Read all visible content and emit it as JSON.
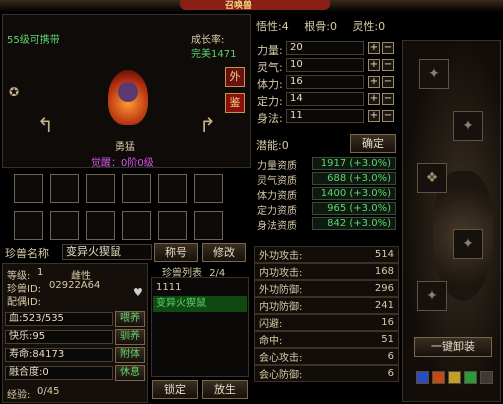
{
  "title": "召唤兽",
  "pet": {
    "level_text": "55级可携带",
    "growth_label": "成长率:",
    "growth_value": "完美1471",
    "name": "勇猛",
    "awaken": "觉醒：0阶0级",
    "btn_wai": "外",
    "btn_jian": "鉴"
  },
  "top_stats": {
    "wuxing_label": "悟性:",
    "wuxing_value": "4",
    "genggu_label": "根骨:",
    "genggu_value": "0",
    "lingxing_label": "灵性:",
    "lingxing_value": "0"
  },
  "attributes": [
    {
      "label": "力量:",
      "value": "20"
    },
    {
      "label": "灵气:",
      "value": "10"
    },
    {
      "label": "体力:",
      "value": "16"
    },
    {
      "label": "定力:",
      "value": "14"
    },
    {
      "label": "身法:",
      "value": "11"
    }
  ],
  "potential": {
    "label": "潜能:",
    "value": "0",
    "confirm": "确定"
  },
  "aptitudes": [
    {
      "label": "力量资质",
      "value": "1917 (+3.0%)"
    },
    {
      "label": "灵气资质",
      "value": "688 (+3.0%)"
    },
    {
      "label": "体力资质",
      "value": "1400 (+3.0%)"
    },
    {
      "label": "定力资质",
      "value": "965 (+3.0%)"
    },
    {
      "label": "身法资质",
      "value": "842 (+3.0%)"
    }
  ],
  "combat_stats": [
    {
      "label": "外功攻击:",
      "value": "514"
    },
    {
      "label": "内功攻击:",
      "value": "168"
    },
    {
      "label": "外功防御:",
      "value": "296"
    },
    {
      "label": "内功防御:",
      "value": "241"
    },
    {
      "label": "闪避:",
      "value": "16"
    },
    {
      "label": "命中:",
      "value": "51"
    },
    {
      "label": "会心攻击:",
      "value": "6"
    },
    {
      "label": "会心防御:",
      "value": "6"
    }
  ],
  "info": {
    "name_label": "珍兽名称",
    "name_value": "变异火猰鼠",
    "title_btn": "称号",
    "modify_btn": "修改",
    "level_label": "等级:",
    "level_value": "1",
    "gender": "雌性",
    "id_label": "珍兽ID:",
    "id_value": "02922A64",
    "mate_label": "配偶ID:",
    "hp_label": "血:",
    "hp_value": "523/535",
    "joy_label": "快乐:",
    "joy_value": "95",
    "life_label": "寿命:",
    "life_value": "84173",
    "fusion_label": "融合度:",
    "fusion_value": "0",
    "exp_label": "经验:",
    "exp_value": "0/45",
    "feed_btn": "喂养",
    "tame_btn": "驯养",
    "attach_btn": "附体",
    "rest_btn": "休息"
  },
  "pet_list": {
    "header": "珍兽列表",
    "count": "2/4",
    "items": [
      "1111",
      "变异火猰鼠"
    ],
    "lock_btn": "锁定",
    "release_btn": "放生"
  },
  "unequip_btn": "一键卸装",
  "colors": {
    "green": "#5fd56f",
    "gold": "#e8c86a",
    "purple": "#d456e8",
    "red": "#c0302a"
  }
}
